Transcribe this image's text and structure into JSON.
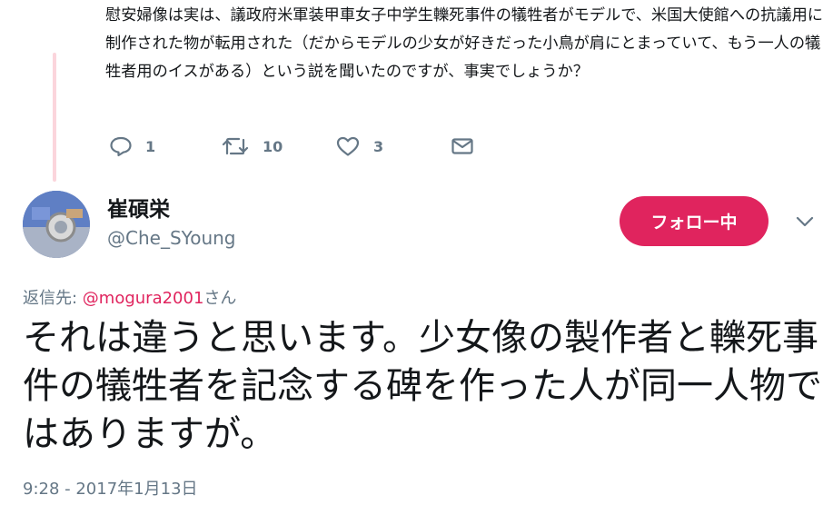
{
  "parent_tweet": {
    "text": "慰安婦像は実は、議政府米軍装甲車女子中学生轢死事件の犠牲者がモデルで、米国大使館への抗議用に制作された物が転用された（だからモデルの少女が好きだった小鳥が肩にとまっていて、もう一人の犠牲者用のイスがある）という説を聞いたのですが、事実でしょうか？",
    "reply_count": "1",
    "retweet_count": "10",
    "like_count": "3"
  },
  "tweet": {
    "display_name": "崔碩栄",
    "handle": "@Che_SYoung",
    "follow_label": "フォロー中",
    "reply_prefix": "返信先: ",
    "reply_mention": "@mogura2001",
    "reply_suffix": "さん",
    "text": "それは違うと思います。少女像の製作者と轢死事件の犠牲者を記念する碑を作った人が同一人物ではありますが。",
    "timestamp": "9:28 - 2017年1月13日"
  },
  "icons": {
    "reply": "reply-icon",
    "retweet": "retweet-icon",
    "like": "heart-icon",
    "dm": "envelope-icon",
    "more": "chevron-down-icon"
  },
  "colors": {
    "accent": "#e0245e",
    "muted": "#657786",
    "text": "#14171a",
    "thread_line": "#fbd5dc"
  }
}
